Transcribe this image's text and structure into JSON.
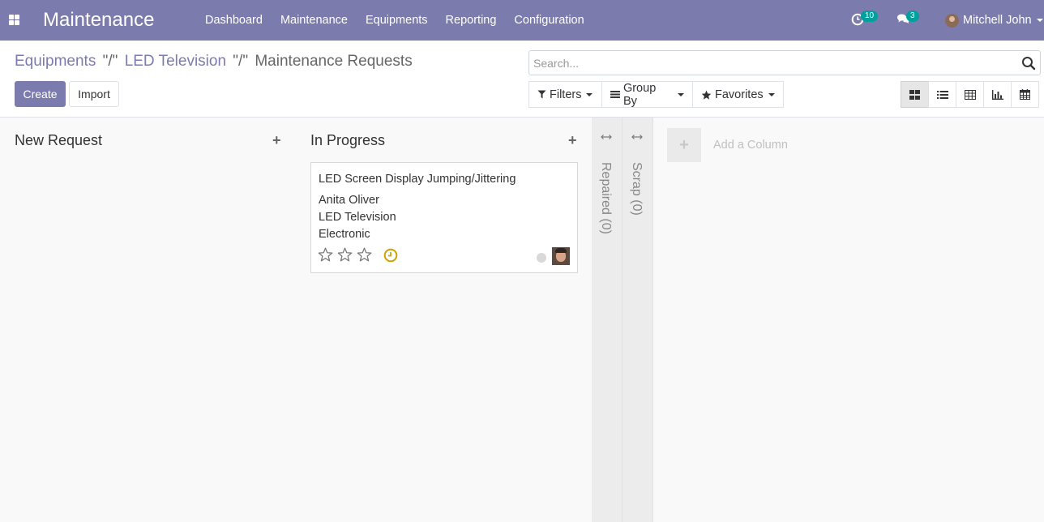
{
  "navbar": {
    "brand": "Maintenance",
    "menu": [
      "Dashboard",
      "Maintenance",
      "Equipments",
      "Reporting",
      "Configuration"
    ],
    "activity_count": "10",
    "message_count": "3",
    "user_name": "Mitchell John",
    "color": "#7c7bad"
  },
  "breadcrumb": {
    "items": [
      "Equipments",
      "LED Television",
      "Maintenance Requests"
    ],
    "separator": "\"/\""
  },
  "actions": {
    "create": "Create",
    "import": "Import"
  },
  "search": {
    "placeholder": "Search..."
  },
  "filters": {
    "filters": "Filters",
    "group_by": "Group By",
    "favorites": "Favorites"
  },
  "views": [
    "kanban",
    "list",
    "pivot",
    "graph",
    "calendar"
  ],
  "kanban": {
    "columns": [
      {
        "title": "New Request",
        "add": "+"
      },
      {
        "title": "In Progress",
        "add": "+"
      }
    ],
    "folded": [
      "Repaired (0)",
      "Scrap (0)"
    ],
    "card": {
      "title": "LED Screen Display Jumping/Jittering",
      "lines": [
        "Anita Oliver",
        "LED Television",
        "Electronic"
      ],
      "rating": 0,
      "rating_max": 3
    },
    "add_column": {
      "icon": "+",
      "label": "Add a Column"
    }
  }
}
